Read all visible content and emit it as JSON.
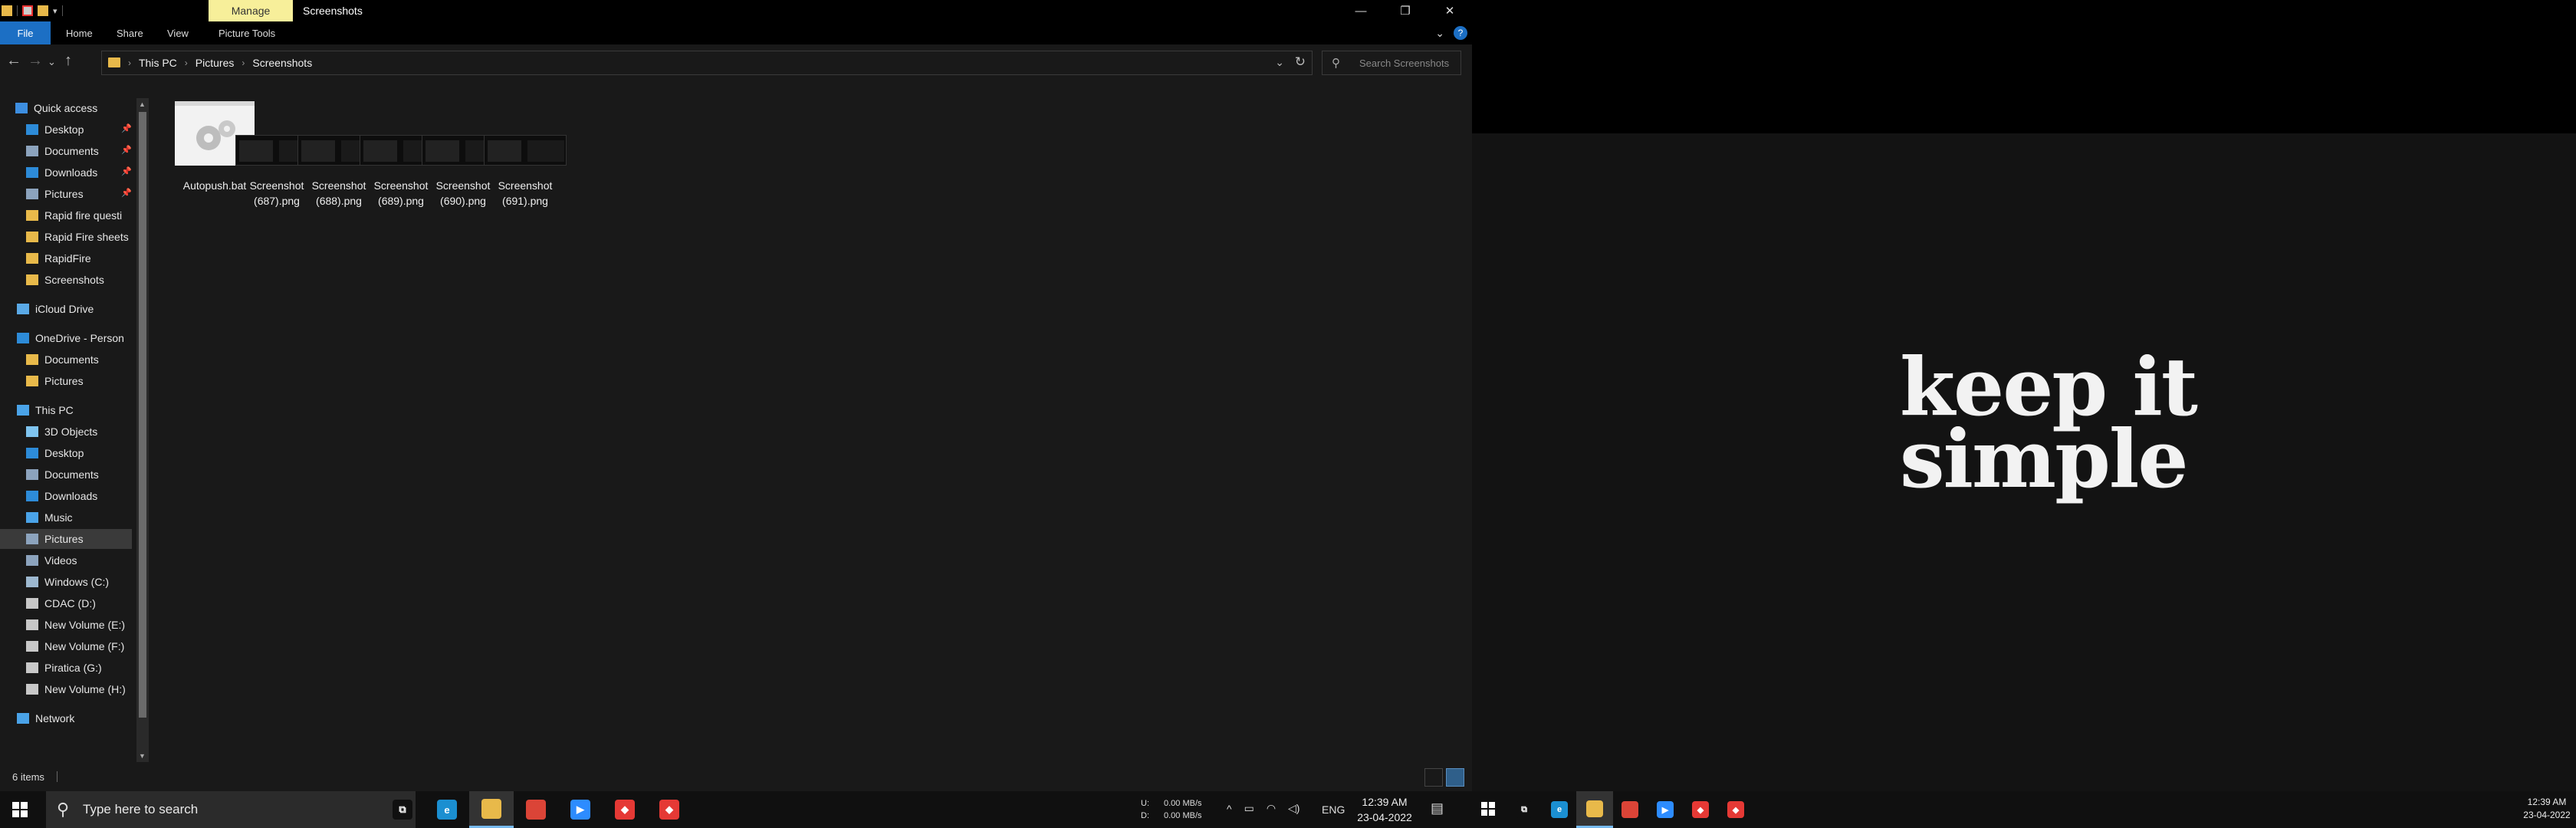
{
  "explorer": {
    "manage_tab": "Manage",
    "window_title": "Screenshots",
    "ribbon": {
      "file": "File",
      "home": "Home",
      "share": "Share",
      "view": "View",
      "picture_tools": "Picture Tools"
    },
    "caption": {
      "minimize": "—",
      "restore": "❐",
      "close": "✕"
    },
    "breadcrumb": [
      "This PC",
      "Pictures",
      "Screenshots"
    ],
    "search_placeholder": "Search Screenshots",
    "nav": [
      {
        "label": "Quick access",
        "icon": "star-icon",
        "color": "#3d8ee0"
      },
      {
        "label": "Desktop",
        "icon": "desktop-folder-icon",
        "color": "#2d8bd8",
        "pinned": true
      },
      {
        "label": "Documents",
        "icon": "documents-folder-icon",
        "color": "#8ca3bd",
        "pinned": true
      },
      {
        "label": "Downloads",
        "icon": "downloads-folder-icon",
        "color": "#2d8bd8",
        "pinned": true
      },
      {
        "label": "Pictures",
        "icon": "pictures-folder-icon",
        "color": "#8ca3bd",
        "pinned": true
      },
      {
        "label": "Rapid fire questi",
        "icon": "folder-icon",
        "color": "#e8b94a"
      },
      {
        "label": "Rapid Fire sheets",
        "icon": "folder-icon",
        "color": "#e8b94a"
      },
      {
        "label": "RapidFire",
        "icon": "folder-icon",
        "color": "#e8b94a"
      },
      {
        "label": "Screenshots",
        "icon": "folder-icon",
        "color": "#e8b94a"
      },
      {
        "label": "iCloud Drive",
        "icon": "icloud-icon",
        "color": "#5aa9e6"
      },
      {
        "label": "OneDrive - Person",
        "icon": "onedrive-icon",
        "color": "#2d8bd8"
      },
      {
        "label": "Documents",
        "icon": "folder-icon",
        "color": "#e8b94a"
      },
      {
        "label": "Pictures",
        "icon": "folder-icon",
        "color": "#e8b94a"
      },
      {
        "label": "This PC",
        "icon": "this-pc-icon",
        "color": "#4aa3e8"
      },
      {
        "label": "3D Objects",
        "icon": "3d-objects-icon",
        "color": "#7fc4ef"
      },
      {
        "label": "Desktop",
        "icon": "desktop-folder-icon",
        "color": "#2d8bd8"
      },
      {
        "label": "Documents",
        "icon": "documents-folder-icon",
        "color": "#8ca3bd"
      },
      {
        "label": "Downloads",
        "icon": "downloads-folder-icon",
        "color": "#2d8bd8"
      },
      {
        "label": "Music",
        "icon": "music-icon",
        "color": "#4aa3e8"
      },
      {
        "label": "Pictures",
        "icon": "pictures-folder-icon",
        "color": "#8ca3bd",
        "selected": true
      },
      {
        "label": "Videos",
        "icon": "videos-folder-icon",
        "color": "#8ca3bd"
      },
      {
        "label": "Windows (C:)",
        "icon": "drive-icon",
        "color": "#9db8cf"
      },
      {
        "label": "CDAC (D:)",
        "icon": "drive-icon",
        "color": "#c8c8c8"
      },
      {
        "label": "New Volume (E:)",
        "icon": "drive-icon",
        "color": "#c8c8c8"
      },
      {
        "label": "New Volume (F:)",
        "icon": "drive-icon",
        "color": "#c8c8c8"
      },
      {
        "label": "Piratica (G:)",
        "icon": "drive-icon",
        "color": "#c8c8c8"
      },
      {
        "label": "New Volume (H:)",
        "icon": "drive-icon",
        "color": "#c8c8c8"
      },
      {
        "label": "Network",
        "icon": "network-icon",
        "color": "#4aa3e8"
      }
    ],
    "files": [
      {
        "name": "Autopush.bat",
        "kind": "bat"
      },
      {
        "name": "Screenshot (687).png",
        "kind": "png"
      },
      {
        "name": "Screenshot (688).png",
        "kind": "png"
      },
      {
        "name": "Screenshot (689).png",
        "kind": "png"
      },
      {
        "name": "Screenshot (690).png",
        "kind": "png"
      },
      {
        "name": "Screenshot (691).png",
        "kind": "png"
      }
    ],
    "status": "6 items"
  },
  "taskbar": {
    "search_placeholder": "Type here to search",
    "apps": [
      {
        "name": "task-view",
        "label": "⧉",
        "color": "#101010"
      },
      {
        "name": "edge",
        "label": "e",
        "color": "#1b8fd1"
      },
      {
        "name": "file-explorer",
        "label": "",
        "color": "#e8b94a",
        "active": true
      },
      {
        "name": "chrome",
        "label": "",
        "color": "#db4437"
      },
      {
        "name": "zoom",
        "label": "▶",
        "color": "#2d8cff"
      },
      {
        "name": "anydesk-1",
        "label": "◆",
        "color": "#e53935"
      },
      {
        "name": "anydesk-2",
        "label": "◆",
        "color": "#e53935"
      }
    ],
    "net": {
      "u_label": "U:",
      "u_value": "0.00 MB/s",
      "d_label": "D:",
      "d_value": "0.00 MB/s"
    },
    "lang": "ENG",
    "time": "12:39 AM",
    "date": "23-04-2022"
  },
  "desktop2": {
    "wallpaper_text_line1": "keep it",
    "wallpaper_text_line2": "simple",
    "time": "12:39 AM",
    "date": "23-04-2022"
  }
}
